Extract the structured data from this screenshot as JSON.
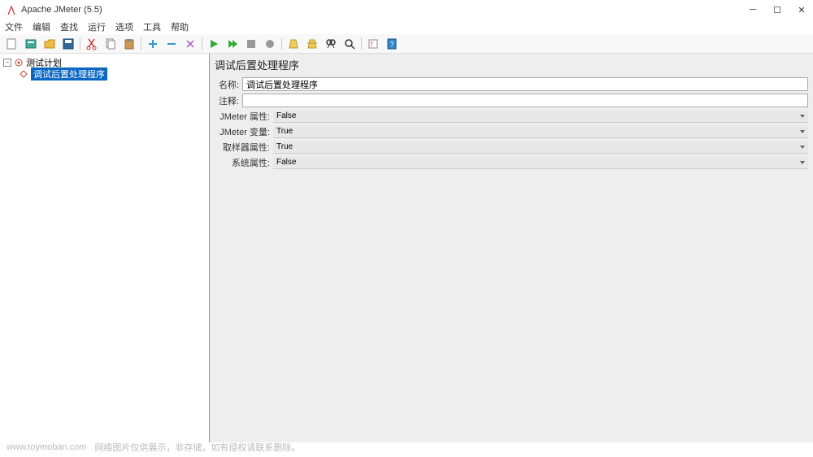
{
  "window": {
    "title": "Apache JMeter (5.5)"
  },
  "menu": {
    "file": "文件",
    "edit": "编辑",
    "search": "查找",
    "run": "运行",
    "options": "选项",
    "tools": "工具",
    "help": "帮助"
  },
  "tree": {
    "root": "测试计划",
    "child": "调试后置处理程序"
  },
  "panel": {
    "title": "调试后置处理程序",
    "name_label": "名称:",
    "name_value": "调试后置处理程序",
    "comment_label": "注释:",
    "comment_value": "",
    "jmeter_props_label": "JMeter 属性:",
    "jmeter_props_value": "False",
    "jmeter_vars_label": "JMeter 变量:",
    "jmeter_vars_value": "True",
    "sampler_props_label": "取样器属性:",
    "sampler_props_value": "True",
    "system_props_label": "系统属性:",
    "system_props_value": "False"
  },
  "footer": {
    "domain": "www.toymoban.com",
    "text": "网络图片仅供展示，非存储，如有侵权请联系删除。"
  }
}
